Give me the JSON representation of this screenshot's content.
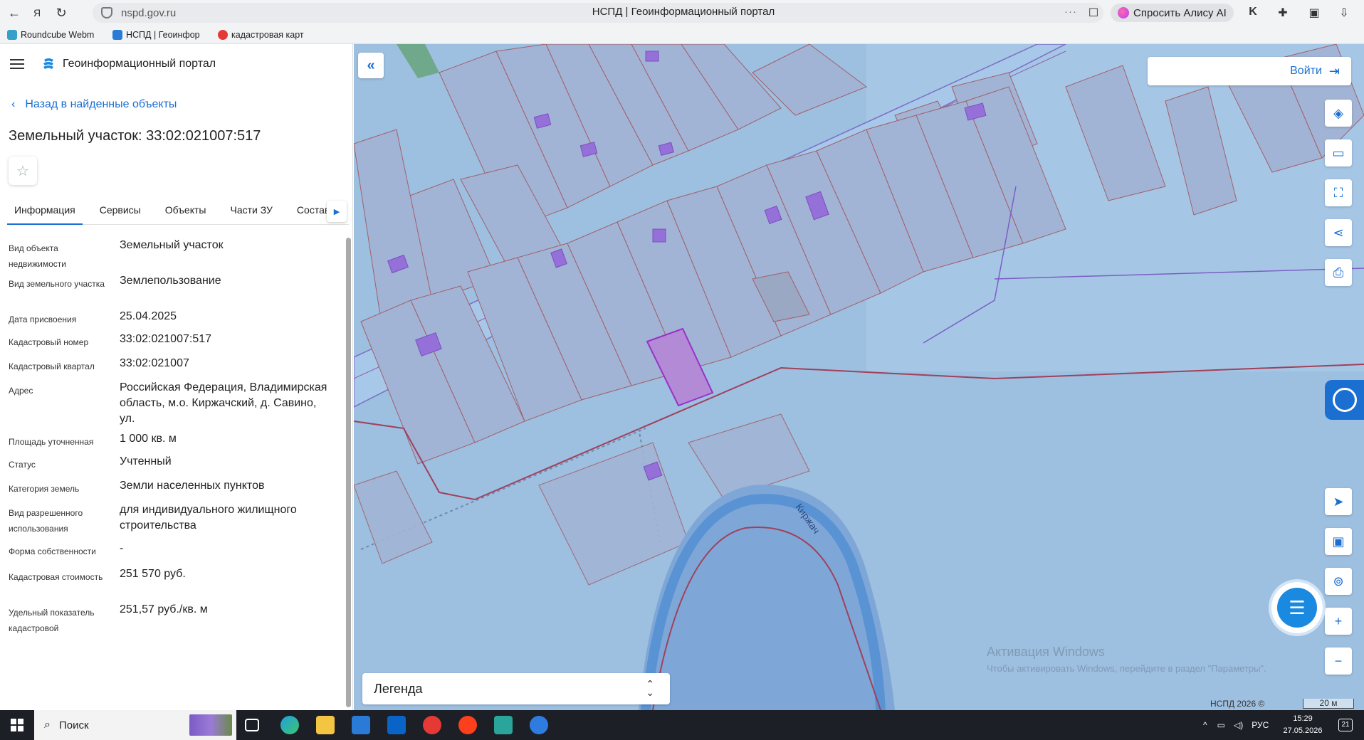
{
  "browser": {
    "url": "nspd.gov.ru",
    "title": "НСПД | Геоинформационный портал",
    "menu_dots": "···",
    "alice_label": "Спросить Алису AI",
    "bookmarks": [
      "Roundcube Webm",
      "НСПД | Геоинфор",
      "кадастровая карт"
    ]
  },
  "panel": {
    "brand": "Геоинформационный портал",
    "back_label": "Назад в найденные объекты",
    "object_title": "Земельный участок: 33:02:021007:517",
    "tabs": [
      "Информация",
      "Сервисы",
      "Объекты",
      "Части ЗУ",
      "Состав"
    ],
    "rows": [
      {
        "k": "Вид объекта недвижимости",
        "v": "Земельный участок"
      },
      {
        "k": "Вид земельного участка",
        "v": "Землепользование"
      },
      {
        "k": "Дата присвоения",
        "v": "25.04.2025"
      },
      {
        "k": "Кадастровый номер",
        "v": "33:02:021007:517"
      },
      {
        "k": "Кадастровый квартал",
        "v": "33:02:021007"
      },
      {
        "k": "Адрес",
        "v": "Российская Федерация, Владимирская область, м.о. Киржачский, д. Савино, ул."
      },
      {
        "k": "Площадь уточненная",
        "v": "1 000 кв. м"
      },
      {
        "k": "Статус",
        "v": "Учтенный"
      },
      {
        "k": "Категория земель",
        "v": "Земли населенных пунктов"
      },
      {
        "k": "Вид разрешенного использования",
        "v": "для индивидуального жилищного строительства"
      },
      {
        "k": "Форма собственности",
        "v": "-"
      },
      {
        "k": "Кадастровая стоимость",
        "v": "251 570 руб."
      },
      {
        "k": "Удельный показатель кадастровой",
        "v": "251,57 руб./кв. м"
      }
    ]
  },
  "map": {
    "login_label": "Войти",
    "legend_label": "Легенда",
    "river_label": "Киржач",
    "copyright": "НСПД 2026 ©",
    "scale_label": "20 м",
    "watermark_title": "Активация Windows",
    "watermark_sub": "Чтобы активировать Windows, перейдите в раздел \"Параметры\".",
    "colors": {
      "land": "#9dbfe0",
      "parcel_line": "#a0606a",
      "highlight": "#9b30c8",
      "building": "#9470d8",
      "river": "#5a93d4"
    }
  },
  "taskbar": {
    "search_label": "Поиск",
    "lang": "РУС",
    "time": "15:29",
    "date": "27.05.2026",
    "notifications": "21"
  }
}
